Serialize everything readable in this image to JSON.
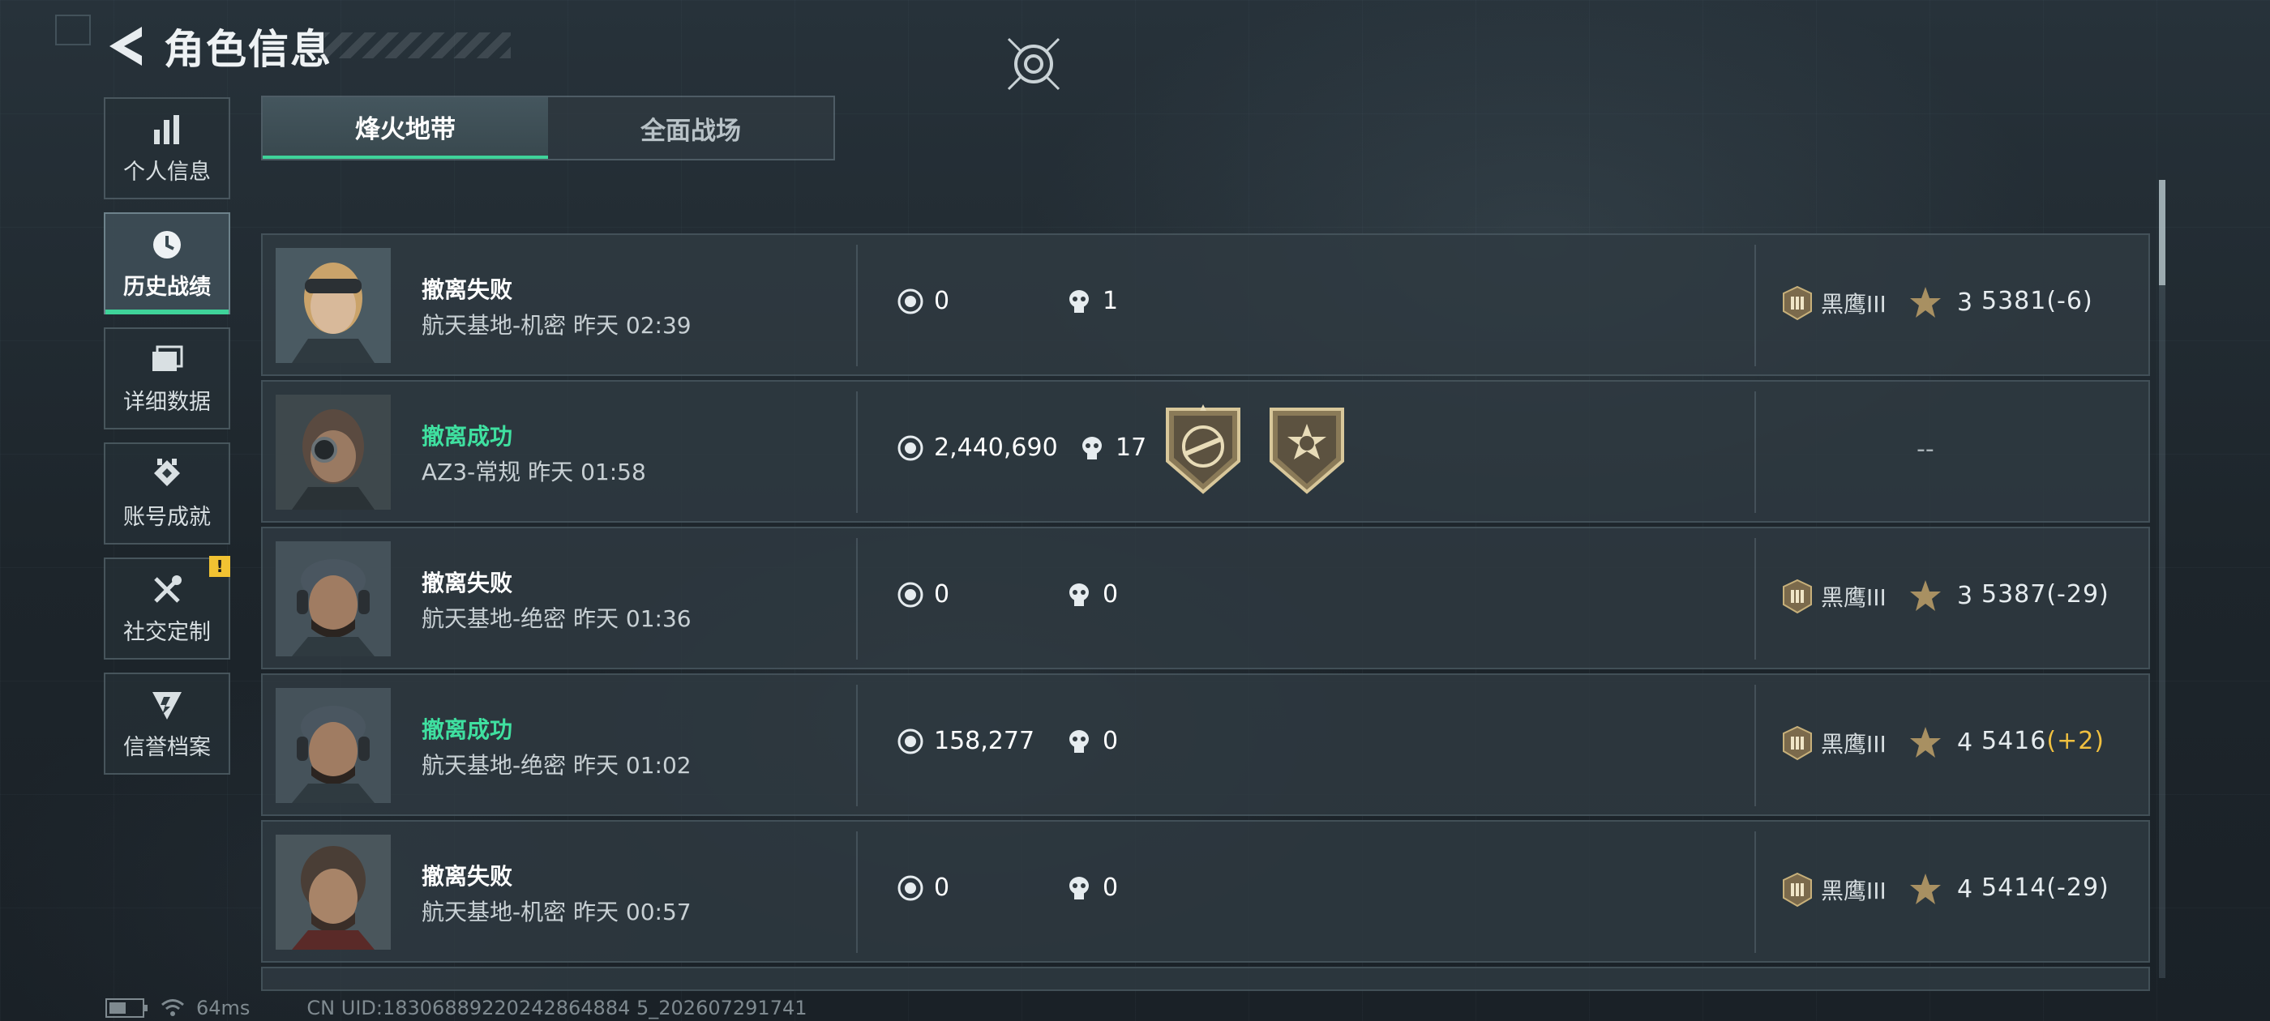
{
  "header": {
    "title": "角色信息"
  },
  "sidebar": {
    "items": [
      {
        "label": "个人信息",
        "icon": "bar-chart-icon"
      },
      {
        "label": "历史战绩",
        "icon": "history-clock-icon",
        "active": true
      },
      {
        "label": "详细数据",
        "icon": "folder-icon"
      },
      {
        "label": "账号成就",
        "icon": "achievement-icon"
      },
      {
        "label": "社交定制",
        "icon": "tools-icon",
        "badge": "!"
      },
      {
        "label": "信誉档案",
        "icon": "credit-shield-icon"
      }
    ]
  },
  "tabs": [
    {
      "label": "烽火地带",
      "active": true
    },
    {
      "label": "全面战场",
      "active": false
    }
  ],
  "matches": [
    {
      "result": "撤离失败",
      "status": "fail",
      "map": "航天基地-机密",
      "time": "昨天 02:39",
      "coins": "0",
      "kills": "1",
      "rank": "黑鹰III",
      "stars": "3",
      "score": "5381(-6)",
      "score_delta": ""
    },
    {
      "result": "撤离成功",
      "status": "success",
      "map": "AZ3-常规",
      "time": "昨天 01:58",
      "coins": "2,440,690",
      "kills": "17",
      "medals": [
        "rifle-medal-icon",
        "skull-burst-medal-icon"
      ],
      "placeholder": "--"
    },
    {
      "result": "撤离失败",
      "status": "fail",
      "map": "航天基地-绝密",
      "time": "昨天 01:36",
      "coins": "0",
      "kills": "0",
      "rank": "黑鹰III",
      "stars": "3",
      "score": "5387(-29)",
      "score_delta": ""
    },
    {
      "result": "撤离成功",
      "status": "success",
      "map": "航天基地-绝密",
      "time": "昨天 01:02",
      "coins": "158,277",
      "kills": "0",
      "rank": "黑鹰III",
      "stars": "4",
      "score": "5416",
      "score_delta": "(+2)"
    },
    {
      "result": "撤离失败",
      "status": "fail",
      "map": "航天基地-机密",
      "time": "昨天 00:57",
      "coins": "0",
      "kills": "0",
      "rank": "黑鹰III",
      "stars": "4",
      "score": "5414(-29)",
      "score_delta": ""
    }
  ],
  "footer": {
    "ping": "64ms",
    "uid": "CN UID:18306889220242864884 5_202607291741"
  },
  "colors": {
    "accent": "#3fd39a",
    "success_text": "#3fe0a0",
    "delta_up": "#f0c040",
    "notice": "#f1c232"
  }
}
